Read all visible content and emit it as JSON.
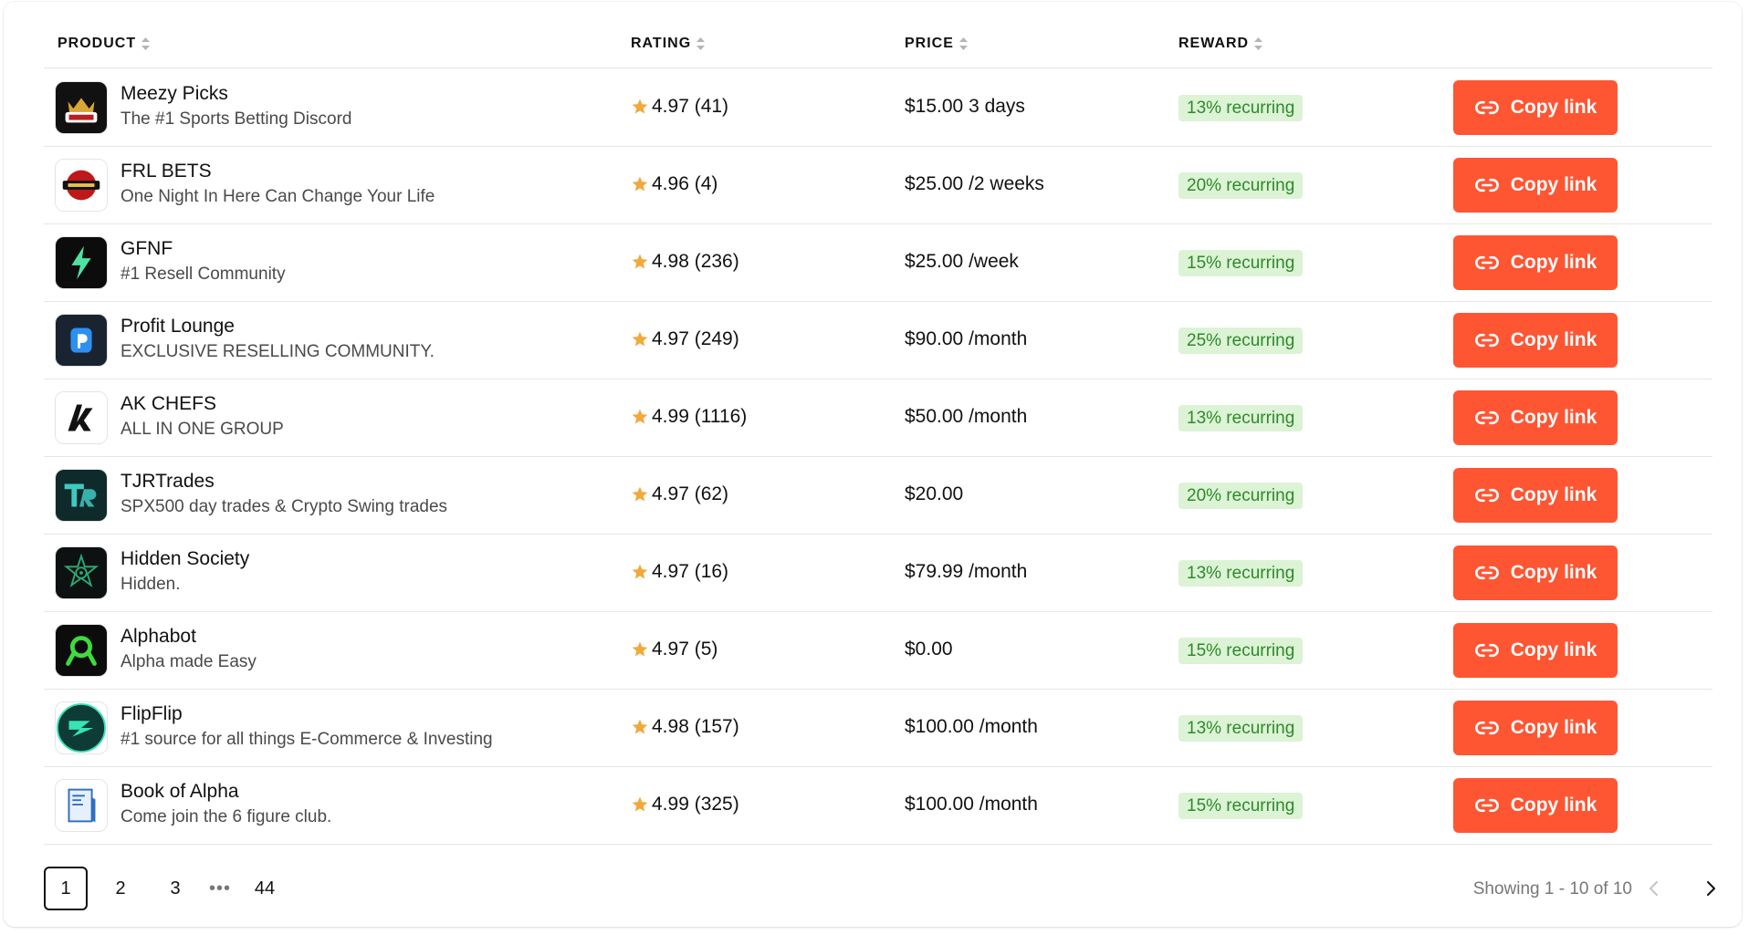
{
  "table": {
    "columns": {
      "product": "PRODUCT",
      "rating": "RATING",
      "price": "PRICE",
      "reward": "REWARD"
    },
    "rows": [
      {
        "name": "Meezy Picks",
        "desc": "The #1 Sports Betting Discord",
        "rating": "4.97 (41)",
        "price": "$15.00 3 days",
        "reward": "13% recurring",
        "button": "Copy link",
        "logo": "meezy-picks-logo"
      },
      {
        "name": "FRL BETS",
        "desc": "One Night In Here Can Change Your Life",
        "rating": "4.96 (4)",
        "price": "$25.00 /2 weeks",
        "reward": "20% recurring",
        "button": "Copy link",
        "logo": "frl-bets-logo"
      },
      {
        "name": "GFNF",
        "desc": "#1 Resell Community",
        "rating": "4.98 (236)",
        "price": "$25.00 /week",
        "reward": "15% recurring",
        "button": "Copy link",
        "logo": "gfnf-logo"
      },
      {
        "name": "Profit Lounge",
        "desc": "EXCLUSIVE RESELLING COMMUNITY.",
        "rating": "4.97 (249)",
        "price": "$90.00 /month",
        "reward": "25% recurring",
        "button": "Copy link",
        "logo": "profit-lounge-logo"
      },
      {
        "name": "AK CHEFS",
        "desc": "ALL IN ONE GROUP",
        "rating": "4.99 (1116)",
        "price": "$50.00 /month",
        "reward": "13% recurring",
        "button": "Copy link",
        "logo": "ak-chefs-logo"
      },
      {
        "name": "TJRTrades",
        "desc": "SPX500 day trades & Crypto Swing trades",
        "rating": "4.97 (62)",
        "price": "$20.00",
        "reward": "20% recurring",
        "button": "Copy link",
        "logo": "tjrtrades-logo"
      },
      {
        "name": "Hidden Society",
        "desc": "Hidden.",
        "rating": "4.97 (16)",
        "price": "$79.99 /month",
        "reward": "13% recurring",
        "button": "Copy link",
        "logo": "hidden-society-logo"
      },
      {
        "name": "Alphabot",
        "desc": "Alpha made Easy",
        "rating": "4.97 (5)",
        "price": "$0.00",
        "reward": "15% recurring",
        "button": "Copy link",
        "logo": "alphabot-logo"
      },
      {
        "name": "FlipFlip",
        "desc": "#1 source for all things E-Commerce & Investing",
        "rating": "4.98 (157)",
        "price": "$100.00 /month",
        "reward": "13% recurring",
        "button": "Copy link",
        "logo": "flipflip-logo"
      },
      {
        "name": "Book of Alpha",
        "desc": "Come join the 6 figure club.",
        "rating": "4.99 (325)",
        "price": "$100.00 /month",
        "reward": "15% recurring",
        "button": "Copy link",
        "logo": "book-of-alpha-logo"
      }
    ]
  },
  "pagination": {
    "pages": [
      "1",
      "2",
      "3"
    ],
    "ellipsis": "•••",
    "last_page": "44",
    "current": "1",
    "showing": "Showing 1 - 10 of 10"
  },
  "colors": {
    "button": "#fe5533",
    "reward_bg": "#dcf3d6",
    "reward_text": "#2f8a2a",
    "star": "#f2a93b"
  }
}
